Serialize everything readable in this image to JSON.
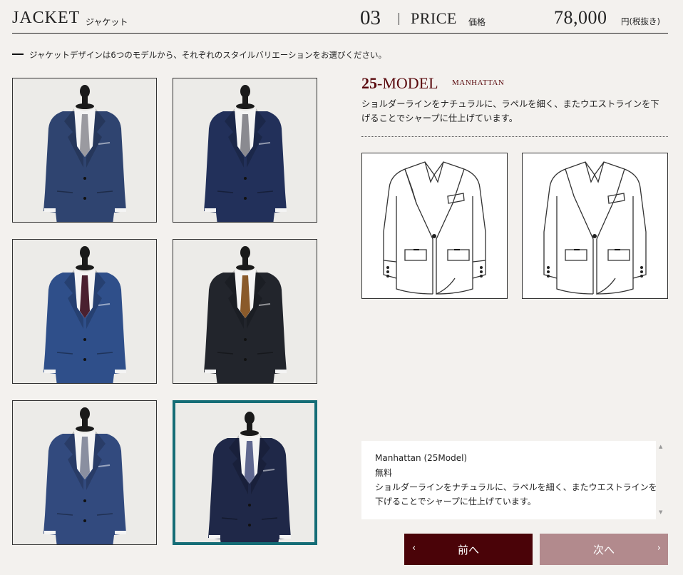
{
  "header": {
    "title": "JACKET",
    "title_jp": "ジャケット",
    "step": "03",
    "price_label": "PRICE",
    "price_label_jp": "価格",
    "price_value": "78,000",
    "price_unit": "円(税抜き)"
  },
  "instruction": "ジャケットデザインは6つのモデルから、それぞれのスタイルバリエーションをお選びください。",
  "thumbnails": [
    {
      "name": "jacket-thumb-1",
      "suit_color": "#2f4470",
      "tie_color": "#9a9aa0",
      "selected": false
    },
    {
      "name": "jacket-thumb-2",
      "suit_color": "#22305a",
      "tie_color": "#8a8a90",
      "selected": false
    },
    {
      "name": "jacket-thumb-3",
      "suit_color": "#2f4f8a",
      "tie_color": "#4a2030",
      "selected": false
    },
    {
      "name": "jacket-thumb-4",
      "suit_color": "#22252c",
      "tie_color": "#8a5a2a",
      "selected": false
    },
    {
      "name": "jacket-thumb-5",
      "suit_color": "#324a7e",
      "tie_color": "#8a8fa0",
      "selected": false
    },
    {
      "name": "jacket-thumb-6",
      "suit_color": "#1f2848",
      "tie_color": "#606890",
      "selected": true
    }
  ],
  "model": {
    "number": "25",
    "label": "-MODEL",
    "name": "MANHATTAN",
    "description": "ショルダーラインをナチュラルに、ラペルを細く、またウエストラインを下げることでシャープに仕上げています。"
  },
  "summary": {
    "line1": "Manhattan (25Model)",
    "line2": "無料",
    "line3": "ショルダーラインをナチュラルに、ラペルを細く、またウエストラインを",
    "line4": "下げることでシャープに仕上げています。"
  },
  "buttons": {
    "prev": "前へ",
    "next": "次へ",
    "prev_color": "#4a0308",
    "next_color": "#b28a8d"
  },
  "colors": {
    "selection_border": "#156d76",
    "model_accent": "#5a0a0e",
    "background": "#f3f1ee"
  }
}
